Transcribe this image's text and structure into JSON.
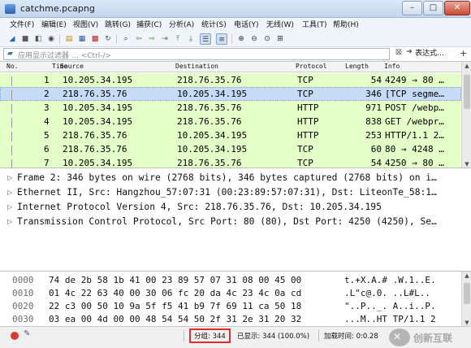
{
  "window": {
    "title": "catchme.pcapng",
    "controls": {
      "minimize": "–",
      "maximize": "□",
      "close": "✕"
    }
  },
  "menubar": [
    "文件(F)",
    "编辑(E)",
    "视图(V)",
    "跳转(G)",
    "捕获(C)",
    "分析(A)",
    "统计(S)",
    "电话(Y)",
    "无线(W)",
    "工具(T)",
    "帮助(H)"
  ],
  "toolbar": {
    "icons": [
      "fin-icon",
      "stop-icon",
      "restart-icon",
      "options-icon",
      "open-icon",
      "save-icon",
      "close-file-icon",
      "reload-icon",
      "find-icon",
      "back-icon",
      "forward-icon",
      "goto-icon",
      "first-icon",
      "last-icon",
      "autoscroll-icon",
      "colorize-icon",
      "zoom-in-icon",
      "zoom-out-icon",
      "zoom-reset-icon",
      "resize-columns-icon"
    ]
  },
  "filter": {
    "placeholder": "应用显示过滤器 … <Ctrl-/>",
    "expression_label": "表达式…",
    "plus_label": "+"
  },
  "packet_list": {
    "columns": [
      "No.",
      "Time",
      "Source",
      "Destination",
      "Protocol",
      "Length",
      "Info"
    ],
    "rows": [
      {
        "no": "1",
        "source": "10.205.34.195",
        "destination": "218.76.35.76",
        "protocol": "TCP",
        "length": "54",
        "info": "4249 → 80 …"
      },
      {
        "no": "2",
        "source": "218.76.35.76",
        "destination": "10.205.34.195",
        "protocol": "TCP",
        "length": "346",
        "info": "[TCP segme…",
        "selected": true
      },
      {
        "no": "3",
        "source": "10.205.34.195",
        "destination": "218.76.35.76",
        "protocol": "HTTP",
        "length": "971",
        "info": "POST /webp…"
      },
      {
        "no": "4",
        "source": "10.205.34.195",
        "destination": "218.76.35.76",
        "protocol": "HTTP",
        "length": "838",
        "info": "GET /webpr…"
      },
      {
        "no": "5",
        "source": "218.76.35.76",
        "destination": "10.205.34.195",
        "protocol": "HTTP",
        "length": "253",
        "info": "HTTP/1.1 2…"
      },
      {
        "no": "6",
        "source": "218.76.35.76",
        "destination": "10.205.34.195",
        "protocol": "TCP",
        "length": "60",
        "info": "80 → 4248 …"
      },
      {
        "no": "7",
        "source": "10.205.34.195",
        "destination": "218.76.35.76",
        "protocol": "TCP",
        "length": "54",
        "info": "4250 → 80 …"
      }
    ]
  },
  "details": [
    "Frame 2: 346 bytes on wire (2768 bits), 346 bytes captured (2768 bits) on i…",
    "Ethernet II, Src: Hangzhou_57:07:31 (00:23:89:57:07:31), Dst: LiteonTe_58:1…",
    "Internet Protocol Version 4, Src: 218.76.35.76, Dst: 10.205.34.195",
    "Transmission Control Protocol, Src Port: 80 (80), Dst Port: 4250 (4250), Se…"
  ],
  "bytes": [
    {
      "offset": "0000",
      "hex": "74 de 2b 58 1b 41 00 23  89 57 07 31 08 00 45 00",
      "ascii": "t.+X.A.# .W.1..E."
    },
    {
      "offset": "0010",
      "hex": "01 4c 22 63 40 00 30 06  fc 20 da 4c 23 4c 0a cd",
      "ascii": ".L\"c@.0. ..L#L.."
    },
    {
      "offset": "0020",
      "hex": "22 c3 00 50 10 9a 5f f5  41 b9 7f 69 11 ca 50 18",
      "ascii": "\"..P.._. A..i..P."
    },
    {
      "offset": "0030",
      "hex": "03 ea 00 4d 00 00 48 54  54 50 2f 31 2e 31 20 32",
      "ascii": "...M..HT TP/1.1 2"
    }
  ],
  "status": {
    "packets": "分组: 344",
    "displayed": "已显示: 344 (100.0%)",
    "load_time": "加载时间: 0:0.28"
  },
  "watermark": "创新互联"
}
